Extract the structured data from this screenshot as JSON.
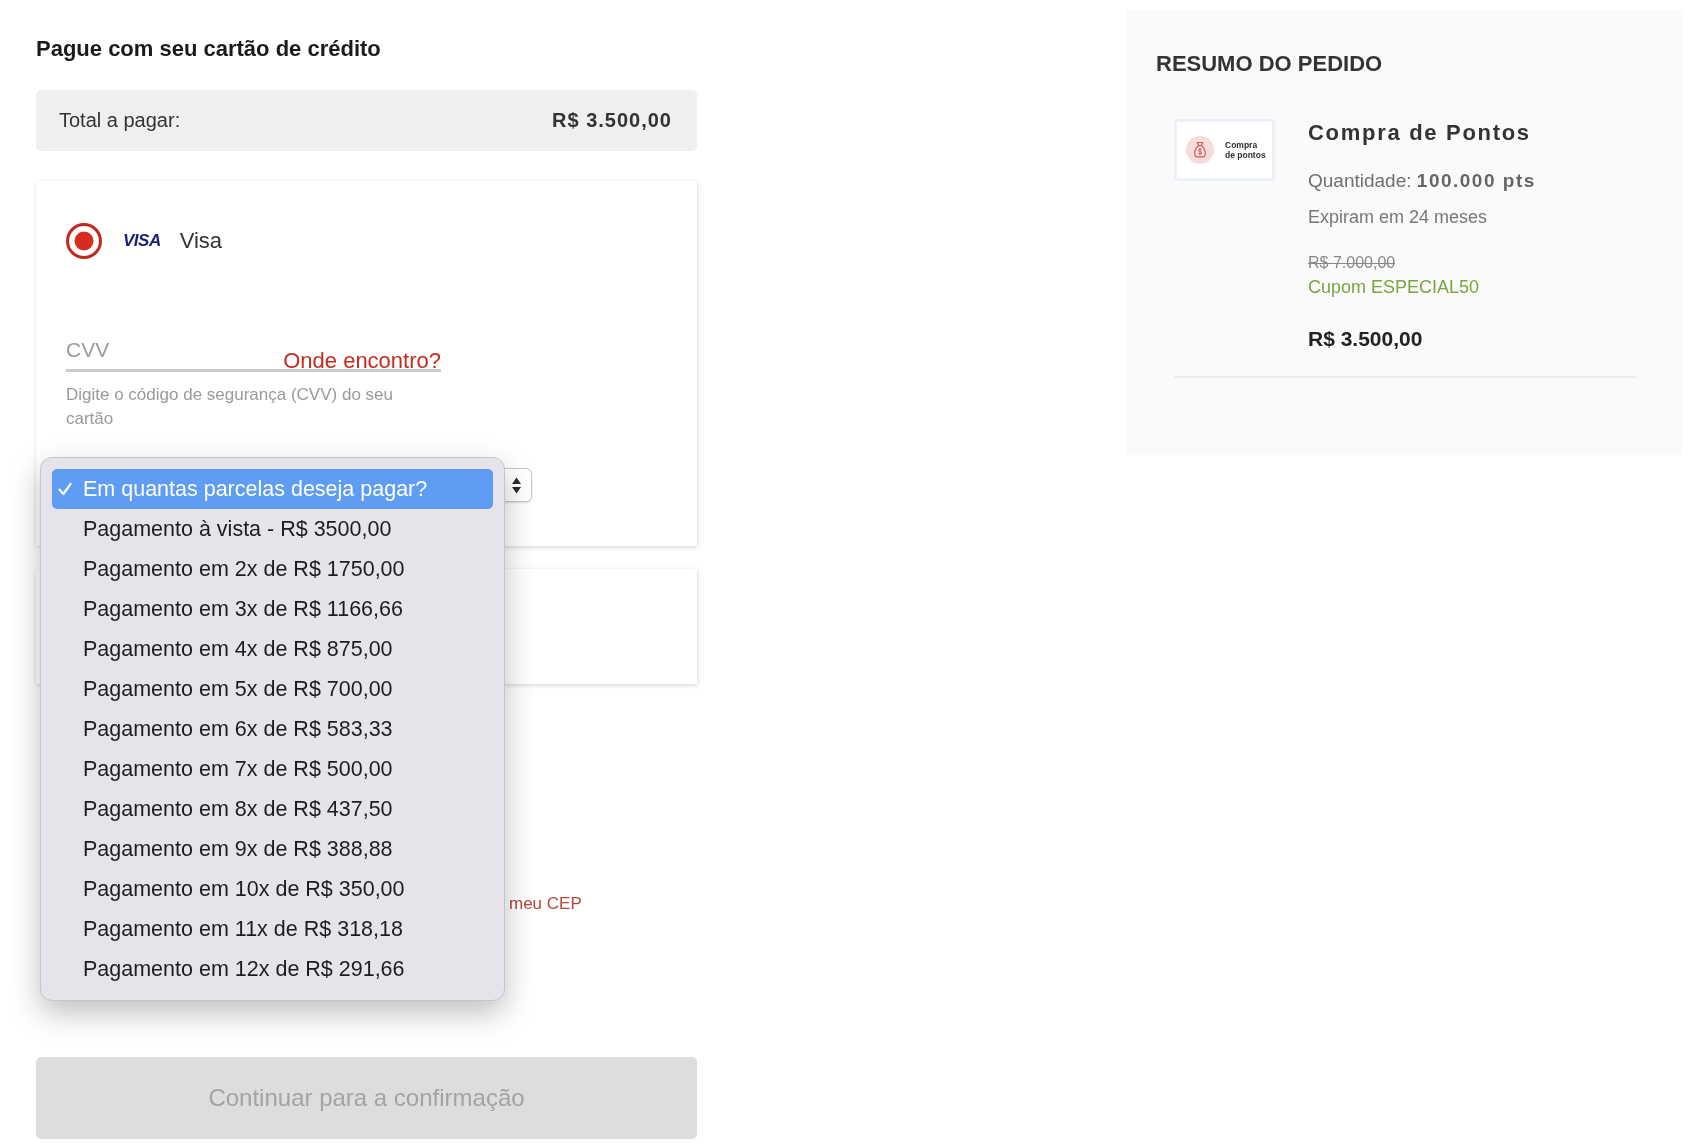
{
  "payment": {
    "title": "Pague com seu cartão de crédito",
    "total": {
      "label": "Total a pagar:",
      "value": "R$ 3.500,00"
    },
    "cards": [
      {
        "brand_mark": "VISA",
        "name": "Visa",
        "selected": true
      }
    ],
    "cvv": {
      "placeholder": "CVV",
      "help_link": "Onde encontro?",
      "hint": "Digite o código de segurança (CVV) do seu cartão"
    },
    "installments": {
      "expanded": true,
      "options": [
        {
          "label": "Em quantas parcelas deseja pagar?",
          "selected": true
        },
        {
          "label": "Pagamento à vista - R$ 3500,00",
          "selected": false
        },
        {
          "label": "Pagamento em 2x de R$ 1750,00",
          "selected": false
        },
        {
          "label": "Pagamento em 3x de R$ 1166,66",
          "selected": false
        },
        {
          "label": "Pagamento em 4x de R$ 875,00",
          "selected": false
        },
        {
          "label": "Pagamento em 5x de R$ 700,00",
          "selected": false
        },
        {
          "label": "Pagamento em 6x de R$ 583,33",
          "selected": false
        },
        {
          "label": "Pagamento em 7x de R$ 500,00",
          "selected": false
        },
        {
          "label": "Pagamento em 8x de R$ 437,50",
          "selected": false
        },
        {
          "label": "Pagamento em 9x de R$ 388,88",
          "selected": false
        },
        {
          "label": "Pagamento em 10x de R$ 350,00",
          "selected": false
        },
        {
          "label": "Pagamento em 11x de R$ 318,18",
          "selected": false
        },
        {
          "label": "Pagamento em 12x de R$ 291,66",
          "selected": false
        }
      ]
    }
  },
  "address": {
    "cep_link": "meu CEP"
  },
  "continue_button": {
    "label": "Continuar para a confirmação",
    "disabled": true
  },
  "order_summary": {
    "title": "RESUMO DO PEDIDO",
    "items": [
      {
        "thumbnail_lines": [
          "Compra",
          "de pontos"
        ],
        "name": "Compra de Pontos",
        "quantity": "Quantidade: **100.000 pts**",
        "expiry": "Expiram em 24 meses",
        "original_price": "R$ 7.000,00",
        "coupon": "Cupom ESPECIAL50",
        "price": "R$ 3.500,00"
      }
    ]
  }
}
